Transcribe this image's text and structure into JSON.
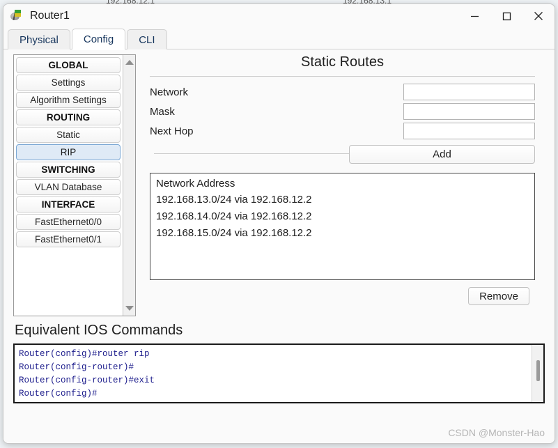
{
  "background": {
    "fragment_left": "192.168.12.1",
    "fragment_right": "192.168.13.1"
  },
  "window": {
    "title": "Router1",
    "icon": "router-icon",
    "controls": {
      "minimize": "minimize-icon",
      "maximize": "maximize-icon",
      "close": "close-icon"
    }
  },
  "tabs": [
    {
      "label": "Physical",
      "active": false
    },
    {
      "label": "Config",
      "active": true
    },
    {
      "label": "CLI",
      "active": false
    }
  ],
  "sidebar": {
    "items": [
      {
        "label": "GLOBAL",
        "type": "header",
        "selected": false
      },
      {
        "label": "Settings",
        "type": "item",
        "selected": false
      },
      {
        "label": "Algorithm Settings",
        "type": "item",
        "selected": false
      },
      {
        "label": "ROUTING",
        "type": "header",
        "selected": false
      },
      {
        "label": "Static",
        "type": "item",
        "selected": false
      },
      {
        "label": "RIP",
        "type": "item",
        "selected": true
      },
      {
        "label": "SWITCHING",
        "type": "header",
        "selected": false
      },
      {
        "label": "VLAN Database",
        "type": "item",
        "selected": false
      },
      {
        "label": "INTERFACE",
        "type": "header",
        "selected": false
      },
      {
        "label": "FastEthernet0/0",
        "type": "item",
        "selected": false
      },
      {
        "label": "FastEthernet0/1",
        "type": "item",
        "selected": false
      }
    ],
    "scrollbar": {
      "up": "scroll-up-arrow-icon",
      "down": "scroll-down-arrow-icon"
    }
  },
  "panel": {
    "title": "Static Routes",
    "fields": [
      {
        "label": "Network",
        "value": "",
        "placeholder": ""
      },
      {
        "label": "Mask",
        "value": "",
        "placeholder": ""
      },
      {
        "label": "Next Hop",
        "value": "",
        "placeholder": ""
      }
    ],
    "add_label": "Add",
    "remove_label": "Remove",
    "routes_header": "Network Address",
    "routes": [
      "192.168.13.0/24 via 192.168.12.2",
      "192.168.14.0/24 via 192.168.12.2",
      "192.168.15.0/24 via 192.168.12.2"
    ]
  },
  "ios": {
    "heading": "Equivalent IOS Commands",
    "lines": [
      "Router(config)#router rip",
      "Router(config-router)#",
      "Router(config-router)#exit",
      "Router(config)#"
    ]
  },
  "watermark": "CSDN @Monster-Hao",
  "colors": {
    "selected_bg": "#dfeaf6",
    "selected_border": "#7aa7d4",
    "ios_text": "#1d1d8c",
    "tab_text": "#17365d",
    "window_bg": "#fafafa"
  }
}
